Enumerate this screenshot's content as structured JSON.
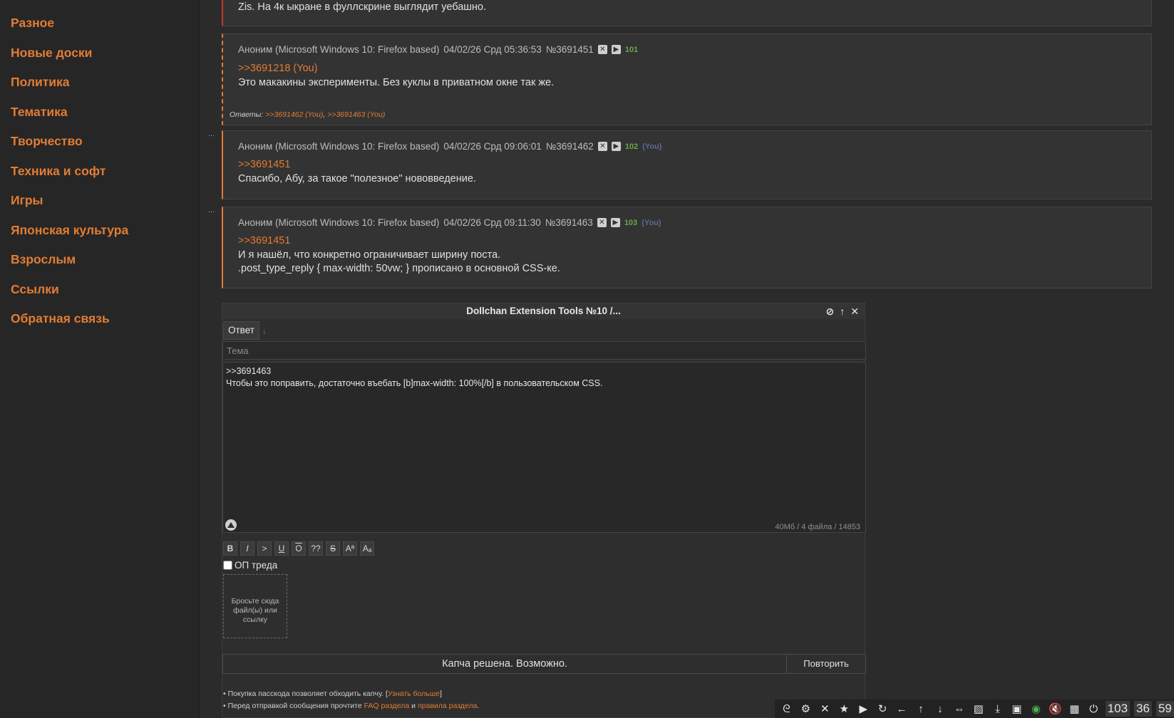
{
  "sidebar": {
    "items": [
      {
        "label": "Разное"
      },
      {
        "label": "Новые доски"
      },
      {
        "label": "Политика"
      },
      {
        "label": "Тематика"
      },
      {
        "label": "Творчество"
      },
      {
        "label": "Техника и софт"
      },
      {
        "label": "Игры"
      },
      {
        "label": "Японская культура"
      },
      {
        "label": "Взрослым"
      },
      {
        "label": "Ссылки"
      },
      {
        "label": "Обратная связь"
      }
    ]
  },
  "posts": {
    "prev": {
      "text": "Zis. На 4к ыкране в фуллскрине выглядит уебашно."
    },
    "p1": {
      "author": "Аноним (Microsoft Windows 10: Firefox based)",
      "date": "04/02/26 Срд 05:36:53",
      "id": "№3691451",
      "num": "101",
      "quote": ">>3691218 (You)",
      "text": "Это макакины эксперименты. Без куклы в приватном окне так же.",
      "replies_label": "Ответы:",
      "reply1": ">>3691462 (You)",
      "reply2": ">>3691463 (You)",
      "sep": ","
    },
    "p2": {
      "author": "Аноним (Microsoft Windows 10: Firefox based)",
      "date": "04/02/26 Срд 09:06:01",
      "id": "№3691462",
      "num": "102",
      "you": "(You)",
      "quote": ">>3691451",
      "text": "Спасибо, Абу, за такое \"полезное\" нововведение."
    },
    "p3": {
      "author": "Аноним (Microsoft Windows 10: Firefox based)",
      "date": "04/02/26 Срд 09:11:30",
      "id": "№3691463",
      "num": "103",
      "you": "(You)",
      "quote": ">>3691451",
      "line1": "И я нашёл, что конкретно ограничивает ширину поста.",
      "line2": ".post_type_reply { max-width: 50vw; } прописано в основной CSS-ке."
    },
    "dots": "..."
  },
  "form": {
    "title": "Dollchan Extension Tools №10 /...",
    "tab_reply": "Ответ",
    "subject_placeholder": "Тема",
    "message": ">>3691463\nЧтобы это поправить, достаточно въебать [b]max-width: 100%[/b] в пользовательском CSS.",
    "limits": "40Мб / 4 файла / 14853",
    "markup": [
      "B",
      "I",
      ">",
      "U",
      "O",
      "??",
      "S",
      "Aª",
      "Aₐ"
    ],
    "op_label": "ОП треда",
    "drop_text": "Бросьте сюда файл(ы) или ссылку",
    "captcha_status": "Капча решена. Возможно.",
    "captcha_retry": "Повторить",
    "note1_prefix": "• Покупка пасскода позволяет обходить капчу. [",
    "note1_link": "Узнать больше",
    "note1_suffix": "]",
    "note2_prefix": "• Перед отправкой сообщения прочтите ",
    "note2_link1": "FAQ раздела",
    "note2_mid": " и ",
    "note2_link2": "правила раздела",
    "note2_suffix": "."
  },
  "toolbar": {
    "counters": [
      "103",
      "36",
      "59"
    ]
  },
  "colors": {
    "accent": "#e37c34",
    "background": "#2b2b2b",
    "post_bg": "#333333"
  }
}
